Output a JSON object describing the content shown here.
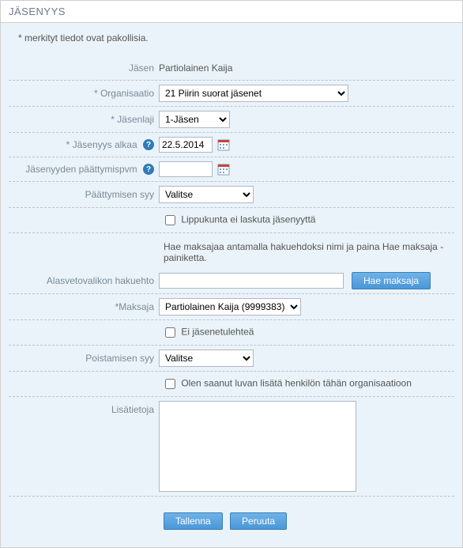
{
  "header": {
    "title": "JÄSENYYS"
  },
  "note": "* merkityt tiedot ovat pakollisia.",
  "form": {
    "jasen": {
      "label": "Jäsen",
      "value": "Partiolainen Kaija"
    },
    "organisaatio": {
      "label": "* Organisaatio",
      "selected": "21 Piirin suorat jäsenet"
    },
    "jasenlaji": {
      "label": "* Jäsenlaji",
      "selected": "1-Jäsen"
    },
    "jasenyys_alkaa": {
      "label": "* Jäsenyys alkaa",
      "value": "22.5.2014"
    },
    "paattymispvm": {
      "label": "Jäsenyyden päättymispvm",
      "value": ""
    },
    "paattymisen_syy": {
      "label": "Päättymisen syy",
      "selected": "Valitse"
    },
    "ei_laskuta": {
      "label": "Lippukunta ei laskuta jäsenyyttä"
    },
    "hae_maksajaa_info": "Hae maksajaa antamalla hakuehdoksi nimi ja paina Hae maksaja -painiketta.",
    "hakuehto": {
      "label": "Alasvetovalikon hakuehto",
      "value": "",
      "button": "Hae maksaja"
    },
    "maksaja": {
      "label": "*Maksaja",
      "selected": "Partiolainen Kaija (9999383)"
    },
    "ei_jasenetulehtea": {
      "label": "Ei jäsenetulehteä"
    },
    "poistamisen_syy": {
      "label": "Poistamisen syy",
      "selected": "Valitse"
    },
    "lupa": {
      "label": "Olen saanut luvan lisätä henkilön tähän organisaatioon"
    },
    "lisatietoja": {
      "label": "Lisätietoja",
      "value": ""
    }
  },
  "actions": {
    "save": "Tallenna",
    "cancel": "Peruuta"
  },
  "icons": {
    "help": "?",
    "calendar": "cal"
  }
}
